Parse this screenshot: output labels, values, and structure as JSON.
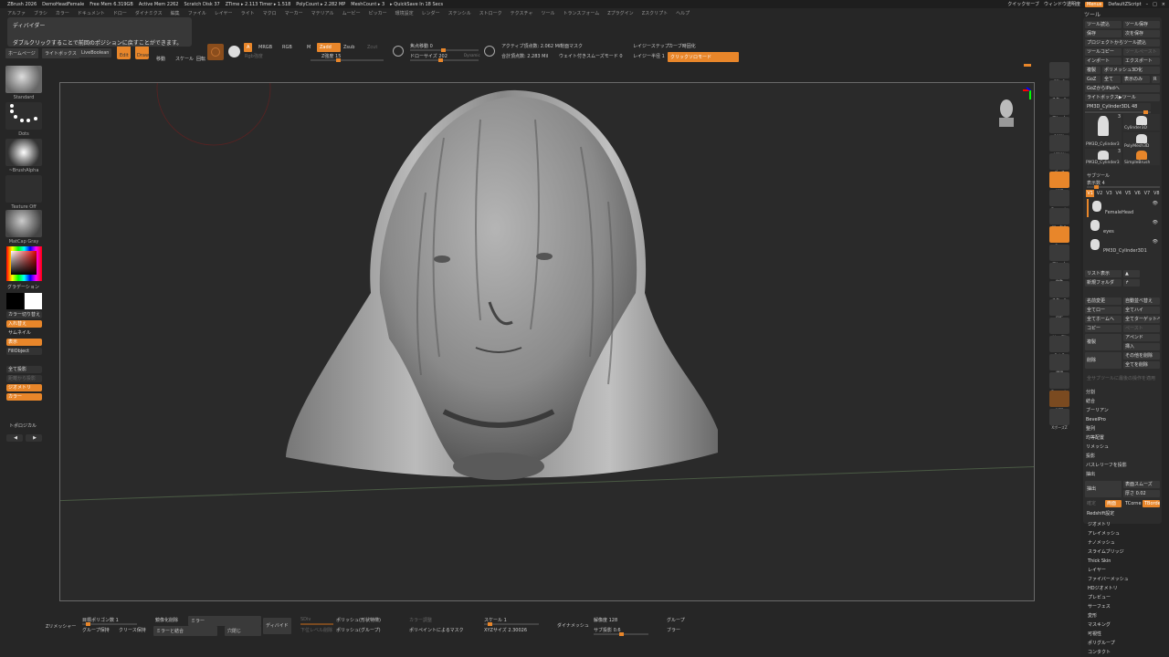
{
  "titlebar": {
    "app": "ZBrush 2026",
    "document": "DemoHeadFemale",
    "stats": [
      "Free Mem 6.319GB",
      "Active Mem 2262",
      "Scratch Disk 37",
      "ZTime ▸ 2.113 Timer ▸ 1.518",
      "PolyCount ▸ 2.282 MP",
      "MeshCount ▸ 3",
      "▸ QuickSave In 18 Secs"
    ],
    "quicksave": "クイックセーブ",
    "window_transparency": "ウィンドウ透明度",
    "menus": "Menus",
    "script": "DefaultZScript"
  },
  "menubar": [
    "アルファ",
    "ブラシ",
    "カラー",
    "ドキュメント",
    "ドロー",
    "ダイナミクス",
    "編集",
    "ファイル",
    "レイヤー",
    "ライト",
    "マクロ",
    "マーカー",
    "マテリアル",
    "ムービー",
    "ピッカー",
    "環境設定",
    "レンダー",
    "ステンシル",
    "ストローク",
    "テクスチャ",
    "ツール",
    "トランスフォーム",
    "Zプラグイン",
    "Zスクリプト",
    "ヘルプ"
  ],
  "tooltip": {
    "title": "ディバイダー",
    "text": "ダブルクリックすることで前回のポジションに戻すことができます。"
  },
  "toolbar": {
    "homepage": "ホームページ",
    "lightbox": "ライトボックス",
    "liveboolean": "LiveBoolean",
    "edit": "Edit",
    "draw": "Draw",
    "move": "移動",
    "scale": "スケール",
    "rotate": "回転",
    "a": "A",
    "mrgb": "MRGB",
    "rgb": "RGB",
    "m": "M",
    "zadd": "Zadd",
    "zsub": "Zsub",
    "zcut": "Zcut",
    "rgb_intensity": "Rgb強度",
    "z_intensity": "Z強度 15",
    "focal_shift": "焦点移動 0",
    "draw_size": "ドローサイズ 202",
    "dynamic": "Dynamic",
    "active_points": "アクティブ頂点数: 2.062 Mil",
    "total_points": "合計頂点数: 2.283 Mil",
    "backface_mask": "背面マスク",
    "weighted_smooth": "ウェイト付きスムーズモード 0",
    "lazy_step": "レイジーステップ",
    "lazy_radius": "レイジー半径 1",
    "curve_bend": "カーブ時固化",
    "click_solo": "クリックソロモード"
  },
  "leftshelf": {
    "brush": "Standard",
    "stroke": "Dots",
    "alpha": "~BrushAlpha",
    "texture": "Texture Off",
    "material": "MatCap Gray",
    "gradient": "グラデーション",
    "switch_color": "カラー切り替え",
    "swap": "入れ替え",
    "thumbnail": "サムネイル",
    "show": "表示",
    "fillobject": "FillObject",
    "project_all": "全て投影",
    "project_from_left": "距離から投影",
    "geometry": "ジオメトリ",
    "color": "カラー",
    "topological": "トポロジカル"
  },
  "rightshelf": [
    "SPix 3",
    "スケール",
    "フレーム",
    "100%",
    "AC50%",
    "パース",
    "XYZ",
    "Dynamic",
    "ローカル",
    "Gxyz",
    "フレーム",
    "移動",
    "スケール",
    "回転",
    "Line Fill",
    "PolyF",
    "透明",
    "Dynamic",
    "ソロ",
    "XポーズZ"
  ],
  "toolpanel": {
    "title": "ツール",
    "load": "ツール読込",
    "save": "ツール保存",
    "saveas": "保存",
    "save_as_next": "次を保存",
    "load_from_project": "プロジェクトからツール読込",
    "copy": "ツールコピー",
    "paste": "ツールペースト",
    "import": "インポート",
    "export": "エクスポート",
    "clone": "複製",
    "make_polymesh": "ポリメッシュ3D化",
    "goz": "GoZ",
    "all": "全て",
    "visible": "表示のみ",
    "r": "R",
    "goz_ipad": "GoZからiPadへ",
    "lightbox_tool": "ライトボックス▶ツール",
    "current_tool": "PM3D_Cylinder3DL 48",
    "tools": [
      {
        "name": "PM3D_Cylinder3",
        "count": "3"
      },
      {
        "name": "Cylinder3D"
      },
      {
        "name": "PolyMesh3D"
      },
      {
        "name": "PM3D_Cylinder3",
        "count": "3"
      },
      {
        "name": "SimpleBrush"
      }
    ],
    "subtool": {
      "title": "サブツール",
      "visible_count": "表示数 4",
      "versions": [
        "V1",
        "V2",
        "V3",
        "V4",
        "V5",
        "V6",
        "V7",
        "V8"
      ],
      "items": [
        "FemaleHead",
        "eyes",
        "PM3D_Cylinder3D1"
      ]
    },
    "list_show": "リスト表示",
    "new_folder": "新規フォルダ",
    "rename": "名前変更",
    "auto_reorder": "自動並べ替え",
    "all_low": "全てロー",
    "all_high": "全てハイ",
    "all_home": "全てホームへ",
    "all_target": "全てターゲットへ",
    "copy2": "コピー",
    "paste2": "ペースト",
    "duplicate": "複製",
    "append": "アペンド",
    "insert": "挿入",
    "delete": "削除",
    "delete_other": "その他を削除",
    "delete_all": "全てを削除",
    "apply_all": "全サブツールに最後の操作を適用",
    "ops": [
      "分割",
      "結合",
      "ブーリアン",
      "BevelPro",
      "整列",
      "均等配置",
      "リメッシュ",
      "投影",
      "バスレリーフを投影",
      "抽出"
    ],
    "extract": "抽出",
    "surface_smooth": "表面スムーズ",
    "thickness": "厚さ 0.02",
    "accept": "確定",
    "double": "両面",
    "tcorne": "TCorne",
    "tborder": "TBorde",
    "redshift": "Redshift設定",
    "sections": [
      "ジオメトリ",
      "アレイメッシュ",
      "ナノメッシュ",
      "スライムブリッジ",
      "Thick Skin",
      "レイヤー",
      "ファイバーメッシュ",
      "HDジオメトリ",
      "プレビュー",
      "サーフェス",
      "変形",
      "マスキング",
      "可視性",
      "ポリグループ",
      "コンタクト"
    ]
  },
  "bottombar": {
    "zremesher": "Zリメッシャー",
    "target_poly": "目標ポリゴン数 1",
    "keep_groups": "グループ保持",
    "keep_creases": "クリース保持",
    "mirror_name": "鏡像化削除",
    "mirror": "ミラー",
    "mirror_weld": "ミラーと結合",
    "close_holes": "穴閉じ",
    "divide": "ディバイド",
    "smt": "SDiv",
    "lower_level_delete": "下位レベル削除",
    "polish_feature": "ポリッシュ(形状特徴)",
    "polish_groups": "ポリッシュ(グループ)",
    "color_adjust": "カラー調整",
    "polypaint_mask": "ポリペイントによるマスク",
    "scale": "スケール 1",
    "xyz_size": "XYZサイズ 2.30026",
    "dynamesh": "ダイナメッシュ",
    "resolution": "解像度 128",
    "subproject": "サブ投影 0.6",
    "groups": "グループ",
    "blur": "ブラー"
  },
  "colors": {
    "accent": "#e8862a",
    "bg": "#262626",
    "canvas": "#2a2a2a"
  }
}
